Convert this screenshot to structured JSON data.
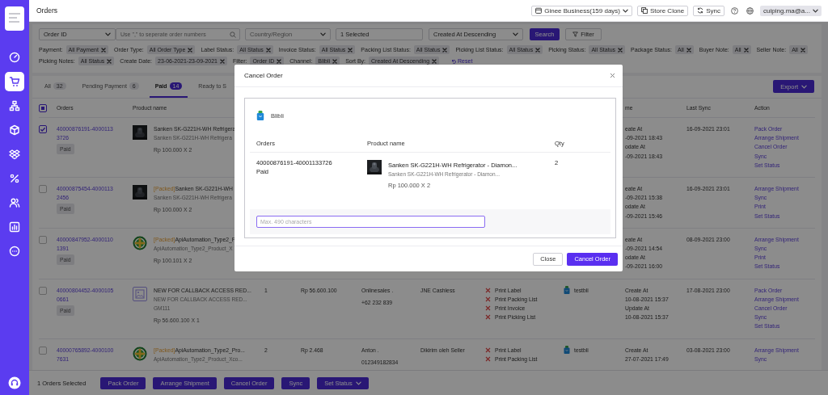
{
  "header": {
    "title": "Orders",
    "business": "Ginee Business(159 days)",
    "store_clone": "Store Clone",
    "sync": "Sync",
    "user": "cuiping.ma@a..."
  },
  "sidebar": {
    "items": [
      {
        "selected": false
      },
      {
        "selected": true
      },
      {
        "selected": false
      },
      {
        "selected": false
      },
      {
        "selected": false
      },
      {
        "selected": false
      },
      {
        "selected": false
      },
      {
        "selected": false
      },
      {
        "selected": false
      }
    ]
  },
  "filters": {
    "order_field": "Order ID",
    "search_placeholder": "Use \",\" to seperate order numbers",
    "country_placeholder": "Country/Region",
    "store": "1 Selected",
    "sort": "Created At Descending",
    "search_button": "Search",
    "filter_button": "Filter",
    "chips": [
      {
        "label": "Payment:",
        "value": "All Payment"
      },
      {
        "label": "Order Type:",
        "value": "All Order Type"
      },
      {
        "label": "Label Status:",
        "value": "All Status"
      },
      {
        "label": "Invoice Status:",
        "value": "All Status"
      },
      {
        "label": "Packing List Status:",
        "value": "All Status"
      },
      {
        "label": "Picking List Status:",
        "value": "All Status"
      },
      {
        "label": "Picking Status:",
        "value": "All Status"
      },
      {
        "label": "Package Status:",
        "value": "All"
      },
      {
        "label": "Buyer Note:",
        "value": "All"
      },
      {
        "label": "Seller Note:",
        "value": "All"
      },
      {
        "label": "Picking Notes:",
        "value": "All Status"
      },
      {
        "label": "Create Date:",
        "value": "23-06-2021-23-09-2021"
      },
      {
        "label": "Filter:",
        "value": "Order ID"
      },
      {
        "label": "Channel:",
        "value": "Blibli"
      },
      {
        "label": "Sort By:",
        "value": "Created At Descending"
      }
    ],
    "reset": "Reset"
  },
  "tabs": [
    {
      "label": "All",
      "count": "32",
      "selected": false
    },
    {
      "label": "Pending Payment",
      "count": "6",
      "selected": false
    },
    {
      "label": "Paid",
      "count": "14",
      "selected": true
    },
    {
      "label": "Ready to S",
      "selected": false
    }
  ],
  "export": "Export",
  "table": {
    "select_all_indeterminate": true,
    "columns": [
      {
        "label": "Orders"
      },
      {
        "label": "Product name"
      },
      {
        "label": "me"
      },
      {
        "label": "Last Sync"
      },
      {
        "label": "Action"
      }
    ],
    "rows": [
      {
        "checked": true,
        "order_id": "40000876191-40001133726",
        "status": "Paid",
        "product": {
          "name": "Sanken SK-G221H-WH Refrigera",
          "subname": "Sanken SK-G221H-WH Refrigera",
          "price": "Rp 100.000 X 2"
        },
        "time": [
          "eate At",
          "-09-2021 18:43",
          "odate At",
          "-09-2021 18:43"
        ],
        "last_sync": "16-09-2021 23:01",
        "actions": [
          "Pack Order",
          "Arrange Shipment",
          "Cancel Order",
          "Sync",
          "Set Status"
        ]
      },
      {
        "checked": false,
        "order_id": "40000875454-40001132456",
        "status": "Paid",
        "product": {
          "tag": "[Packed]",
          "name": "Sanken SK-G221H-WH",
          "subname": "Sanken SK-G221H-WH Refrigera",
          "price": "Rp 100.000 X 2"
        },
        "time": [
          "eate At",
          "-09-2021 15:38",
          "odate At",
          "-09-2021 15:46"
        ],
        "last_sync": "16-09-2021 23:01",
        "actions": [
          "Arrange Shipment",
          "Sync",
          "Print",
          "Set Status"
        ]
      },
      {
        "checked": false,
        "order_id": "40000847952-40001101391",
        "status": "Paid",
        "product": {
          "kind": "logo",
          "tag": "[Packed]",
          "name": "ApiAutomation_Type2_P",
          "subname": "ApiAutomation_Type2_Product_X",
          "price": "Rp 100.101 X 2"
        },
        "time": [
          "eate At",
          "-09-2021 14:54",
          "odate At",
          "-09-2021 16:00"
        ],
        "last_sync": "08-09-2021 23:00",
        "actions": [
          "Arrange Shipment",
          "Sync",
          "Print",
          "Set Status"
        ]
      },
      {
        "checked": false,
        "order_id": "40000804452-40001050661",
        "status": "Paid",
        "product": {
          "kind": "placeholder",
          "name": "NEW FOR CALLBACK ACCESS RED...",
          "subname": "NEW FOR CALLBACK ACCESS RED...",
          "sku": "GM111",
          "price": "Rp 56.600.100 X 1"
        },
        "qty": "1",
        "total": "Rp 56.600.100",
        "buyer": [
          "Onlinesales .",
          "+62 232 839"
        ],
        "shipping": "JNE Cashless",
        "prints": [
          {
            "label": "Print Label",
            "done": false
          },
          {
            "label": "Print Packing List",
            "done": false
          },
          {
            "label": "Print Invoice",
            "done": false
          },
          {
            "label": "Print Picking List",
            "done": false
          }
        ],
        "store": "testbli",
        "time": [
          "Create At",
          "10-08-2021 15:37",
          "Update At",
          "10-08-2021 15:37"
        ],
        "last_sync": "17-08-2021 23:00",
        "actions": [
          "Pack Order",
          "Arrange Shipment",
          "Cancel Order",
          "Sync",
          "Set Status"
        ]
      },
      {
        "checked": false,
        "order_id": "40000765892-40001007631",
        "product": {
          "kind": "logo",
          "tag": "[Packed]",
          "name": "ApiAutomation_Type2_Pro...",
          "subname": "ApiAutomation_Type2_Product_Xco..."
        },
        "qty": "2",
        "total": "Rp 2.468",
        "buyer": [
          "Anton .",
          "012349182834"
        ],
        "shipping": "Dikirim oleh Seller",
        "prints": [
          {
            "label": "Print Label",
            "done": false
          },
          {
            "label": "Print Packing List",
            "done": false
          }
        ],
        "store": "testbli",
        "time": [
          "Create At",
          "27-07-2021 17:49"
        ],
        "last_sync": "03-08-2021 23:00",
        "actions": [
          "Arrange Shipment",
          "Sync"
        ]
      }
    ]
  },
  "bottom_bar": {
    "selected_count": "1 Orders Selected",
    "buttons": [
      "Pack Order",
      "Arrange Shipment",
      "Cancel Order",
      "Sync"
    ],
    "set_status": "Set Status"
  },
  "modal": {
    "title": "Cancel Order",
    "channel": "Blibli",
    "columns": [
      "Orders",
      "Product name",
      "Qty"
    ],
    "order_id": "40000876191-40001133726",
    "status": "Paid",
    "product_name": "Sanken SK-G221H-WH Refrigerator - Diamon...",
    "product_subname": "Sanken SK-G221H-WH Refrigerator - Diamon...",
    "price": "Rp 100.000 X 2",
    "qty": "2",
    "reason_placeholder": "Max. 490 characters",
    "close": "Close",
    "confirm": "Cancel Order"
  }
}
